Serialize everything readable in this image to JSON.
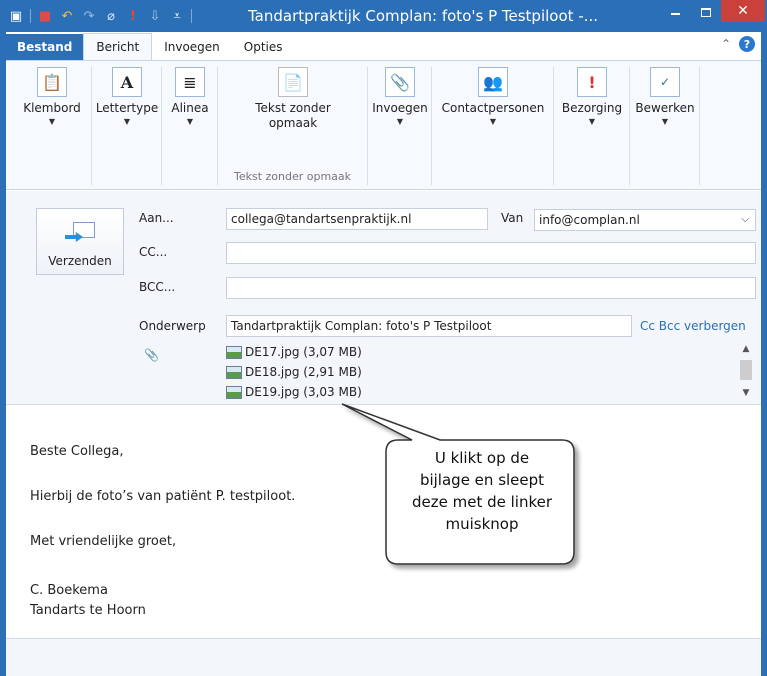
{
  "window": {
    "title": "Tandartpraktijk Complan:  foto's P Testpiloot -...",
    "close_label": "✕"
  },
  "ribbon": {
    "tabs": [
      {
        "label": "Bestand"
      },
      {
        "label": "Bericht"
      },
      {
        "label": "Invoegen"
      },
      {
        "label": "Opties"
      }
    ],
    "groups": [
      {
        "label": "Klembord",
        "icon": "clipboard-icon",
        "dropdown": true
      },
      {
        "label": "Lettertype",
        "icon": "font-icon",
        "dropdown": true
      },
      {
        "label": "Alinea",
        "icon": "paragraph-icon",
        "dropdown": true
      },
      {
        "label": "Tekst zonder",
        "label2": "opmaak",
        "icon": "plain-text-icon",
        "caption": "Tekst zonder opmaak"
      },
      {
        "label": "Invoegen",
        "icon": "paperclip-icon",
        "dropdown": true
      },
      {
        "label": "Contactpersonen",
        "icon": "contacts-icon",
        "dropdown": true
      },
      {
        "label": "Bezorging",
        "icon": "importance-icon",
        "dropdown": true
      },
      {
        "label": "Bewerken",
        "icon": "spelling-icon",
        "dropdown": true
      }
    ]
  },
  "compose": {
    "send_label": "Verzenden",
    "to_label": "Aan...",
    "to_value": "collega@tandartsenpraktijk.nl",
    "from_label": "Van",
    "from_value": "info@complan.nl",
    "cc_label": "CC...",
    "cc_value": "",
    "bcc_label": "BCC...",
    "bcc_value": "",
    "subject_label": "Onderwerp",
    "subject_value": "Tandartpraktijk Complan:  foto's P Testpiloot",
    "cc_bcc_link": "Cc  Bcc verbergen",
    "attachments": [
      {
        "name": "DE17.jpg (3,07 MB)"
      },
      {
        "name": "DE18.jpg (2,91 MB)"
      },
      {
        "name": "DE19.jpg (3,03 MB)"
      }
    ]
  },
  "body": {
    "lines": [
      "Beste Collega,",
      "Hierbij de foto’s van patiënt P. testpiloot.",
      "Met vriendelijke groet,",
      "C. Boekema",
      "Tandarts te Hoorn"
    ]
  },
  "callout": {
    "lines": [
      "U klikt op de",
      "bijlage en sleept",
      "deze met de linker",
      "muisknop"
    ]
  }
}
